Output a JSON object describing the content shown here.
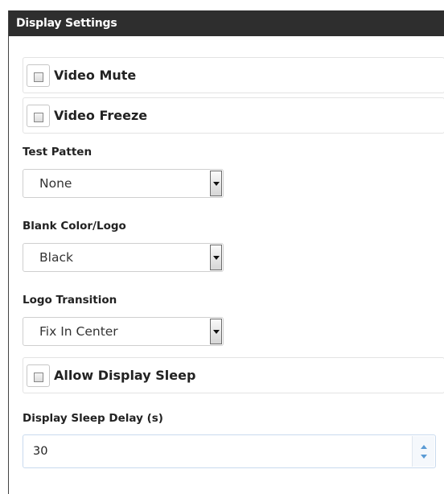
{
  "panel": {
    "title": "Display Settings"
  },
  "video_mute": {
    "label": "Video Mute",
    "checked": false
  },
  "video_freeze": {
    "label": "Video Freeze",
    "checked": false
  },
  "test_pattern": {
    "label": "Test Patten",
    "value": "None"
  },
  "blank_color_logo": {
    "label": "Blank Color/Logo",
    "value": "Black"
  },
  "logo_transition": {
    "label": "Logo Transition",
    "value": "Fix In Center"
  },
  "allow_display_sleep": {
    "label": "Allow Display Sleep",
    "checked": false
  },
  "display_sleep_delay": {
    "label": "Display Sleep Delay (s)",
    "value": "30"
  }
}
